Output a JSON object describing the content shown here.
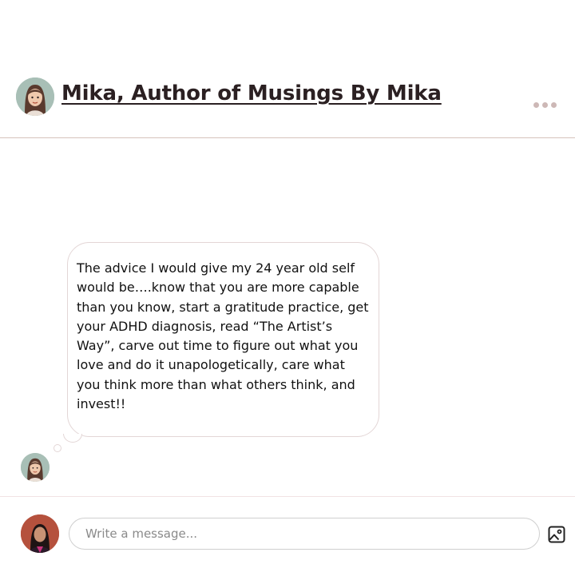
{
  "header": {
    "title": "Mika, Author of Musings By Mika",
    "avatar": "author-avatar",
    "more_icon": "more-dots-icon"
  },
  "message": {
    "text": "The advice I would give my 24 year old self would be….know that you are more capable than you know, start a gratitude practice, get your ADHD diagnosis, read “The Artist’s Way”, carve out time to figure out what you love and do it unapologetically, care what you think more than what others think, and invest!!"
  },
  "composer": {
    "placeholder": "Write a message...",
    "image_icon": "image-icon"
  },
  "colors": {
    "divider": "#d7c3bb",
    "avatar_bg": "#a8bfb6",
    "dots": "#cdb8b6",
    "bubble_border": "#e3d6d6"
  }
}
